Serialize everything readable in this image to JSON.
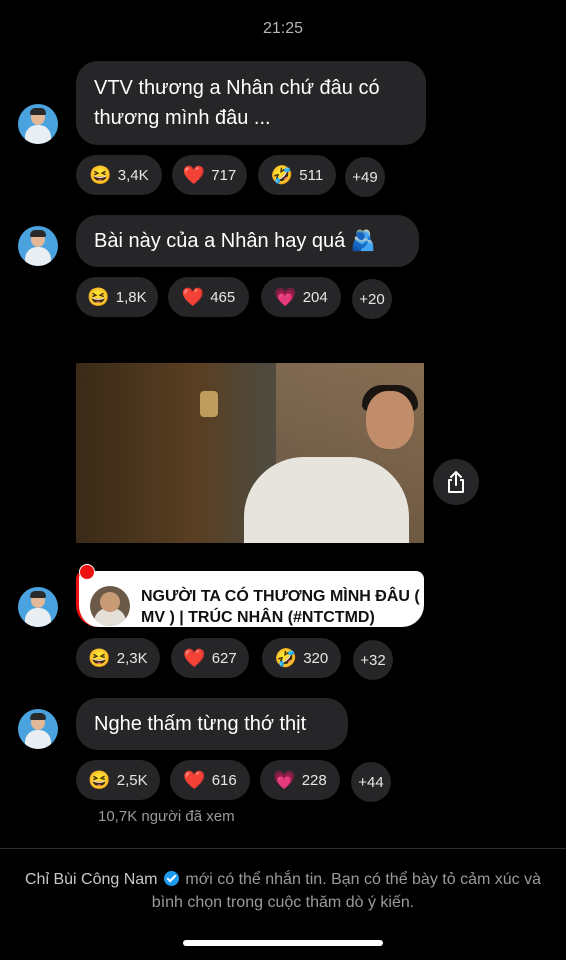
{
  "status": {
    "time": "21:25"
  },
  "messages": [
    {
      "text": "VTV thương a Nhân chứ đâu có thương mình đâu ...",
      "reactions": [
        {
          "icon": "grinning-squint-emoji",
          "emoji": "😆",
          "count": "3,4K"
        },
        {
          "icon": "red-heart-emoji",
          "emoji": "❤️",
          "count": "717"
        },
        {
          "icon": "rofl-emoji",
          "emoji": "🤣",
          "count": "511"
        }
      ],
      "more": "+49"
    },
    {
      "text": "Bài này của a Nhân hay quá 🫂",
      "reactions": [
        {
          "icon": "grinning-squint-emoji",
          "emoji": "😆",
          "count": "1,8K"
        },
        {
          "icon": "red-heart-emoji",
          "emoji": "❤️",
          "count": "465"
        },
        {
          "icon": "pink-heart-emoji",
          "emoji": "💗",
          "count": "204"
        }
      ],
      "more": "+20"
    },
    {
      "link_title": "NGƯỜI TA CÓ THƯƠNG MÌNH ĐÂU ( MV ) | TRÚC NHÂN (#NTCTMD)",
      "reactions": [
        {
          "icon": "grinning-squint-emoji",
          "emoji": "😆",
          "count": "2,3K"
        },
        {
          "icon": "red-heart-emoji",
          "emoji": "❤️",
          "count": "627"
        },
        {
          "icon": "rofl-emoji",
          "emoji": "🤣",
          "count": "320"
        }
      ],
      "more": "+32"
    },
    {
      "text": "Nghe thấm từng thớ thịt",
      "reactions": [
        {
          "icon": "grinning-squint-emoji",
          "emoji": "😆",
          "count": "2,5K"
        },
        {
          "icon": "red-heart-emoji",
          "emoji": "❤️",
          "count": "616"
        },
        {
          "icon": "pink-heart-emoji",
          "emoji": "💗",
          "count": "228"
        }
      ],
      "more": "+44"
    }
  ],
  "viewers": "10,7K người đã xem",
  "footer": {
    "name": "Chỉ Bùi Công Nam",
    "note": "mới có thể nhắn tin. Bạn có thể bày tỏ cảm xúc và bình chọn trong cuộc thăm dò ý kiến."
  },
  "colors": {
    "background": "#000000",
    "bubble": "#262628",
    "verified": "#1d9bf0",
    "live_dot": "#ee1111"
  }
}
